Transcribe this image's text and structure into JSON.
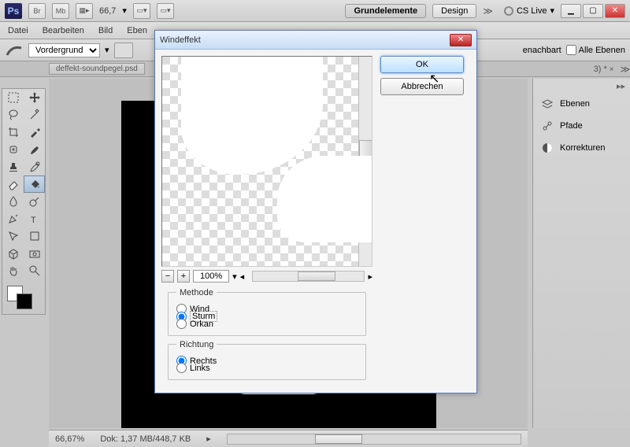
{
  "top": {
    "ps": "Ps",
    "br": "Br",
    "mb": "Mb",
    "zoom": "66,7",
    "workspace_active": "Grundelemente",
    "workspace2": "Design",
    "cs_live": "CS Live"
  },
  "menu": {
    "datei": "Datei",
    "bearbeiten": "Bearbeiten",
    "bild": "Bild",
    "ebene_partial": "Eben"
  },
  "opts": {
    "vordergrund": "Vordergrund",
    "benachbart": "enachbart",
    "alle_ebenen": "Alle Ebenen",
    "fragment": "3) *"
  },
  "doc": {
    "tab": "deffekt-soundpegel.psd"
  },
  "panels": {
    "ebenen": "Ebenen",
    "pfade": "Pfade",
    "korrekturen": "Korrekturen"
  },
  "status": {
    "zoom": "66,67%",
    "dok": "Dok: 1,37 MB/448,7 KB"
  },
  "dialog": {
    "title": "Windeffekt",
    "ok": "OK",
    "cancel": "Abbrechen",
    "zoom": "100%",
    "methode_label": "Methode",
    "methode": {
      "wind": "Wind",
      "sturm": "Sturm",
      "orkan": "Orkan"
    },
    "richtung_label": "Richtung",
    "richtung": {
      "rechts": "Rechts",
      "links": "Links"
    }
  }
}
